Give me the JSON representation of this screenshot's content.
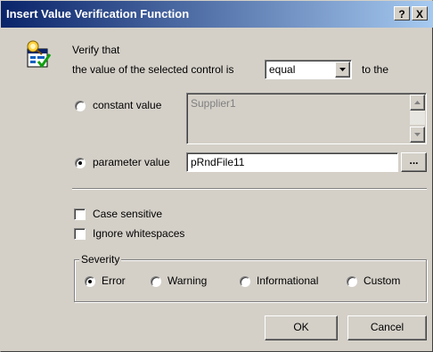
{
  "window": {
    "title": "Insert Value Verification Function",
    "help_label": "?",
    "close_label": "X"
  },
  "verify": {
    "verify_that": "Verify that",
    "prefix": "the value of the selected control is",
    "operator_value": "equal",
    "suffix": "to the"
  },
  "constant": {
    "label": "constant value",
    "value": "Supplier1",
    "selected": false
  },
  "parameter": {
    "label": "parameter value",
    "value": "pRndFile11",
    "selected": true,
    "browse_label": "..."
  },
  "options": {
    "case_sensitive": "Case sensitive",
    "ignore_whitespaces": "Ignore whitespaces"
  },
  "severity": {
    "label": "Severity",
    "items": [
      "Error",
      "Warning",
      "Informational",
      "Custom"
    ],
    "selected": "Error"
  },
  "buttons": {
    "ok": "OK",
    "cancel": "Cancel"
  },
  "icons": {
    "verify": "verify-document-icon",
    "dropdown": "chevron-down-icon",
    "scroll_up": "scroll-up-arrow-icon",
    "scroll_down": "scroll-down-arrow-icon"
  },
  "colors": {
    "title_start": "#0a246a",
    "title_end": "#a6caf0",
    "face": "#d4d0c8"
  }
}
